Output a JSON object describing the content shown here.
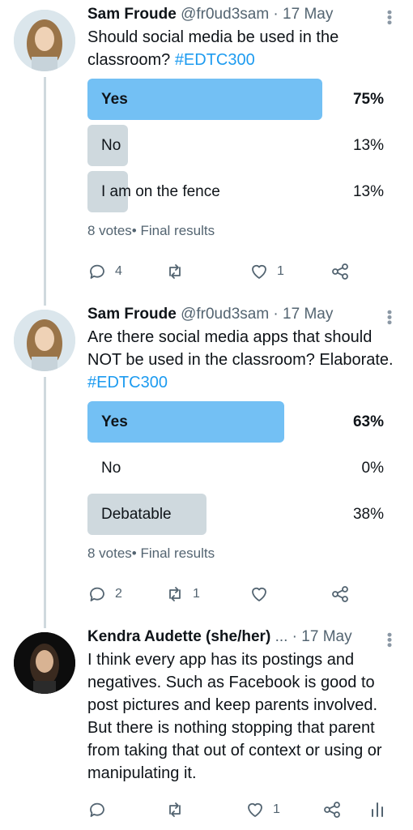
{
  "tweets": [
    {
      "name": "Sam Froude",
      "handle": "@fr0ud3sam",
      "date": "17 May",
      "text_before": "Should social media be used in the classroom? ",
      "hashtag": "#EDTC300",
      "poll": {
        "options": [
          {
            "label": "Yes",
            "percent_text": "75%",
            "percent": 75,
            "winner": true
          },
          {
            "label": "No",
            "percent_text": "13%",
            "percent": 13,
            "winner": false
          },
          {
            "label": "I am on the fence",
            "percent_text": "13%",
            "percent": 13,
            "winner": false
          }
        ],
        "summary": "8 votes• Final results"
      },
      "actions": {
        "replies": "4",
        "retweets": "",
        "likes": "1"
      }
    },
    {
      "name": "Sam Froude",
      "handle": "@fr0ud3sam",
      "date": "17 May",
      "text_before": "Are there social media apps that should NOT be used in the classroom? Elaborate. ",
      "hashtag": "#EDTC300",
      "poll": {
        "options": [
          {
            "label": "Yes",
            "percent_text": "63%",
            "percent": 63,
            "winner": true
          },
          {
            "label": "No",
            "percent_text": "0%",
            "percent": 0,
            "winner": false
          },
          {
            "label": "Debatable",
            "percent_text": "38%",
            "percent": 38,
            "winner": false
          }
        ],
        "summary": "8 votes• Final results"
      },
      "actions": {
        "replies": "2",
        "retweets": "1",
        "likes": ""
      }
    },
    {
      "name": "Kendra Audette (she/her)",
      "handle": "...",
      "date": "17 May",
      "text": "I think every app has its postings and negatives. Such as Facebook is good to post pictures and keep parents involved. But there is nothing stopping that parent from taking that out of context or using or manipulating it.",
      "actions": {
        "replies": "",
        "retweets": "",
        "likes": "1"
      }
    }
  ],
  "separator": " · ",
  "icons": [
    "reply-icon",
    "retweet-icon",
    "like-icon",
    "share-icon",
    "analytics-icon",
    "more-icon"
  ],
  "colors": {
    "accent": "#1d9bf0",
    "winner_bar": "#73c0f4",
    "bar": "#cfd9de",
    "muted": "#536471"
  }
}
